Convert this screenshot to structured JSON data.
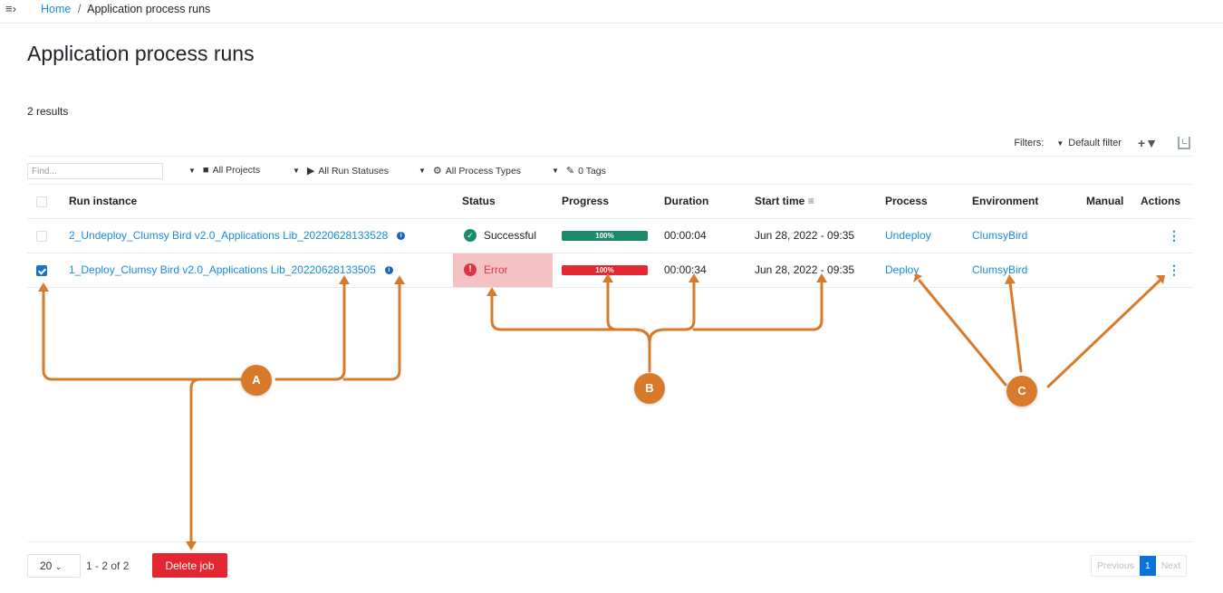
{
  "breadcrumb": {
    "menu_icon": "sidebar-toggle-icon",
    "home": "Home",
    "separator": "/",
    "current": "Application process runs"
  },
  "page": {
    "title": "Application process runs",
    "results": "2 results"
  },
  "filters": {
    "label": "Filters:",
    "selected": "Default filter",
    "add_filter_icon": "+▼",
    "save_icon": "save-filter-icon"
  },
  "toolbar": {
    "find_placeholder": "Find...",
    "dropdowns": [
      {
        "label": "All Projects",
        "icon": "briefcase-icon"
      },
      {
        "label": "All Run Statuses",
        "icon": "play-circle-icon"
      },
      {
        "label": "All Process Types",
        "icon": "gear-icon"
      },
      {
        "label": "0 Tags",
        "icon": "tag-icon"
      }
    ]
  },
  "table": {
    "columns": [
      "Run instance",
      "Status",
      "Progress",
      "Duration",
      "Start time",
      "Process",
      "Environment",
      "Manual",
      "Actions"
    ],
    "rows": [
      {
        "checked": false,
        "run_instance": "2_Undeploy_Clumsy Bird v2.0_Applications Lib_20220628133528",
        "status": "Successful",
        "status_type": "success",
        "progress": 100,
        "progress_label": "100%",
        "progress_color": "#1b8a6b",
        "duration": "00:00:04",
        "start_time": "Jun 28, 2022 - 09:35",
        "process": "Undeploy",
        "environment": "ClumsyBird",
        "manual": ""
      },
      {
        "checked": true,
        "run_instance": "1_Deploy_Clumsy Bird v2.0_Applications Lib_20220628133505",
        "status": "Error",
        "status_type": "error",
        "progress": 100,
        "progress_label": "100%",
        "progress_color": "#e32630",
        "duration": "00:00:34",
        "start_time": "Jun 28, 2022 - 09:35",
        "process": "Deploy",
        "environment": "ClumsyBird",
        "manual": ""
      }
    ]
  },
  "footer": {
    "page_size": "20",
    "range": "1 - 2 of 2",
    "delete_label": "Delete job",
    "previous": "Previous",
    "current_page": "1",
    "next": "Next"
  },
  "annotations": {
    "a": "A",
    "b": "B",
    "c": "C",
    "color": "#d97a2b"
  }
}
